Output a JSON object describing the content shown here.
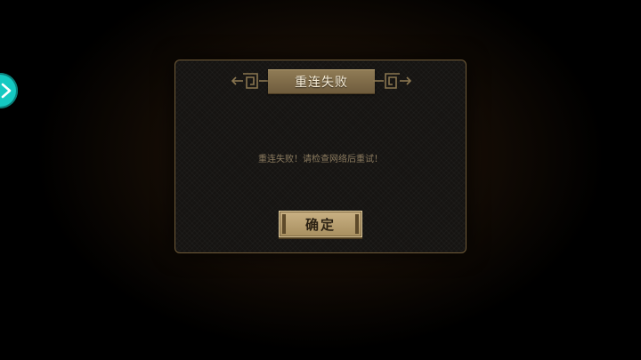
{
  "side_button": {
    "icon": "chevron-right-icon",
    "color": "#14c9c2"
  },
  "dialog": {
    "title": "重连失败",
    "message": "重连失败！请检查网络后重试！",
    "confirm_label": "确定",
    "border_color": "#6f5a37",
    "title_plate_color": "#7e6a47",
    "button_color": "#c4ab7d"
  }
}
